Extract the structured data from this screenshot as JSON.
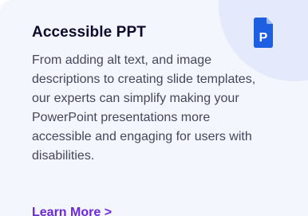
{
  "card": {
    "title": "Accessible PPT",
    "description": "From adding alt text, and image descriptions to creating slide templates, our experts can simplify making your PowerPoint presentations more accessible and engaging for users with disabilities.",
    "link_label": "Learn More >",
    "icon": "powerpoint-file-icon",
    "icon_letter": "P"
  },
  "colors": {
    "card_background": "#f3f6fc",
    "corner_blob": "#e4eafb",
    "icon_blue": "#1d5fe0",
    "title": "#0b0b2b",
    "body_text": "#45475a",
    "link": "#6d28d9"
  }
}
